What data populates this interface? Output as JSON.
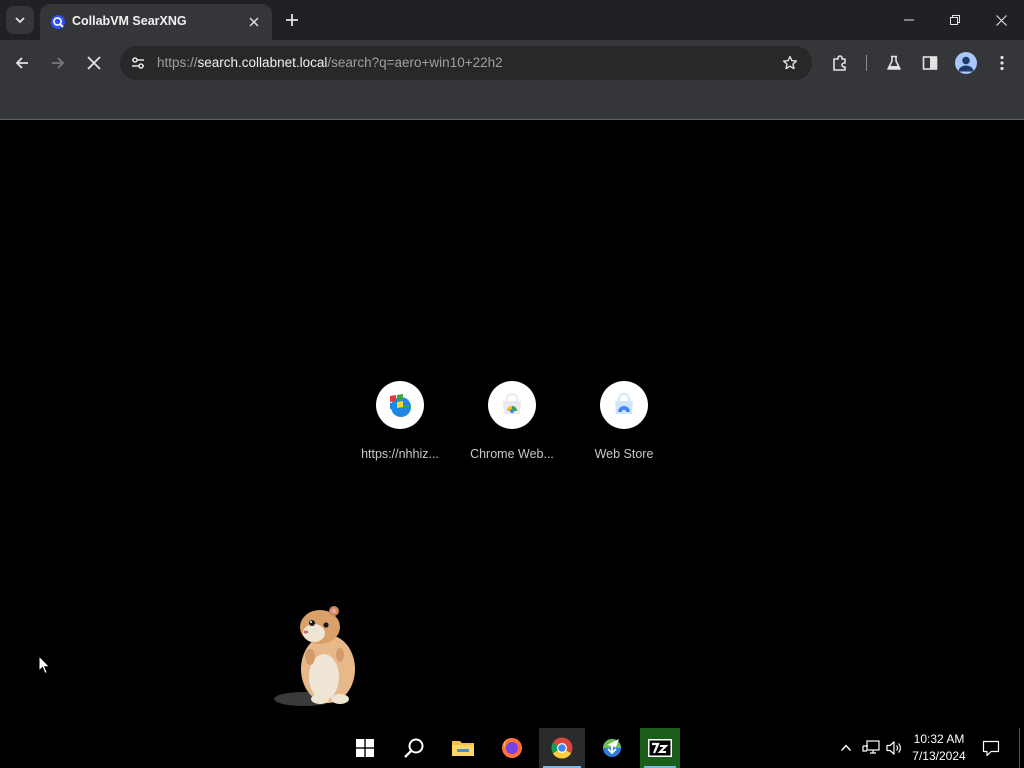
{
  "browser": {
    "tab": {
      "title": "CollabVM SearXNG"
    },
    "address_bar": {
      "scheme": "https://",
      "host": "search.collabnet.local",
      "path": "/search?q=aero+win10+22h2"
    }
  },
  "shortcuts": [
    {
      "label": "https://nhhiz...",
      "icon": "windows-flag-icon"
    },
    {
      "label": "Chrome Web...",
      "icon": "chrome-web-store-icon"
    },
    {
      "label": "Web Store",
      "icon": "web-store-icon"
    }
  ],
  "taskbar": {
    "apps": [
      "start",
      "search",
      "file-explorer",
      "firefox",
      "chrome",
      "internet-download-manager",
      "7-zip"
    ],
    "clock": {
      "time": "10:32 AM",
      "date": "7/13/2024"
    }
  },
  "colors": {
    "tabstrip": "#202124",
    "toolbar": "#35363a",
    "omnibox": "#282828",
    "accent": "#76b9ed"
  }
}
